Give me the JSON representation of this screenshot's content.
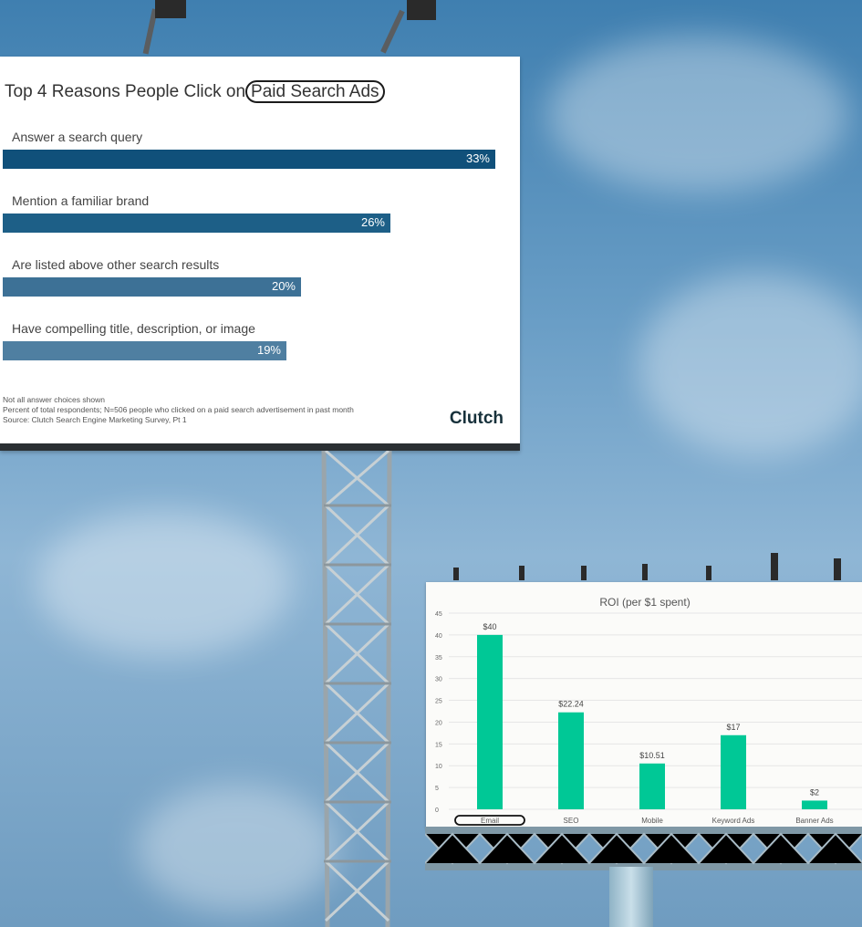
{
  "billboard_top": {
    "title_prefix": "Top 4 Reasons People Click on",
    "title_circled": "Paid Search Ads",
    "footnotes": [
      "Not all answer choices shown",
      "Percent of total respondents; N=506 people who clicked on a paid search advertisement in past month",
      "Source: Clutch Search Engine Marketing Survey, Pt 1"
    ],
    "logo": "Clutch"
  },
  "billboard_bottom": {
    "title": "ROI (per $1 spent)"
  },
  "chart_data": [
    {
      "type": "bar",
      "orientation": "horizontal",
      "title": "Top 4 Reasons People Click on Paid Search Ads",
      "categories": [
        "Answer a search query",
        "Mention a familiar brand",
        "Are listed above other search results",
        "Have compelling title, description, or image"
      ],
      "values": [
        33,
        26,
        20,
        19
      ],
      "value_labels": [
        "33%",
        "26%",
        "20%",
        "19%"
      ],
      "unit": "%",
      "colors": [
        "#10507a",
        "#1d5f87",
        "#3d7196",
        "#4f7fa1"
      ],
      "grid": false
    },
    {
      "type": "bar",
      "title": "ROI (per $1 spent)",
      "categories": [
        "Email",
        "SEO",
        "Mobile",
        "Keyword Ads",
        "Banner Ads"
      ],
      "values": [
        40,
        22.24,
        10.51,
        17,
        2
      ],
      "value_labels": [
        "$40",
        "$22.24",
        "$10.51",
        "$17",
        "$2"
      ],
      "ylim": [
        0,
        45
      ],
      "yticks": [
        0,
        5,
        10,
        15,
        20,
        25,
        30,
        35,
        40,
        45
      ],
      "bar_color": "#00c896",
      "circled_category": "Email",
      "grid": true
    }
  ]
}
